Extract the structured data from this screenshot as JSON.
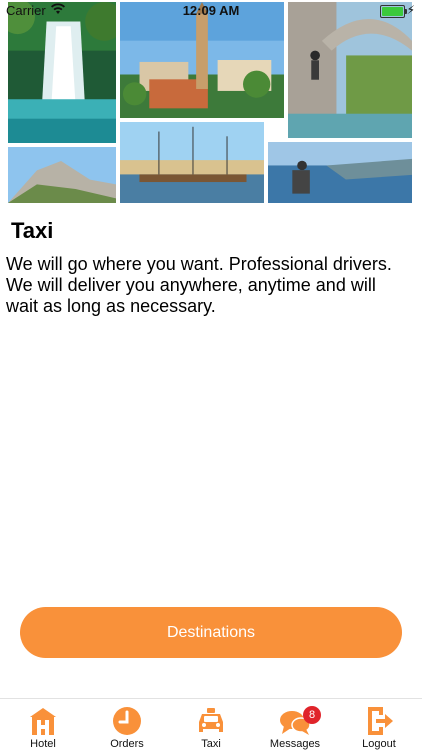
{
  "status_bar": {
    "carrier": "Carrier",
    "time": "12:09 AM",
    "battery_level": 1.0
  },
  "page": {
    "title": "Taxi",
    "description": "We will go where you want. Professional drivers. We will deliver you anywhere, anytime and will wait as long as necessary."
  },
  "primary_button": {
    "label": "Destinations"
  },
  "tabbar": {
    "items": [
      {
        "label": "Hotel",
        "icon": "hotel-icon"
      },
      {
        "label": "Orders",
        "icon": "clock-icon"
      },
      {
        "label": "Taxi",
        "icon": "taxi-icon"
      },
      {
        "label": "Messages",
        "icon": "chat-bubbles-icon",
        "badge": "8"
      },
      {
        "label": "Logout",
        "icon": "logout-icon"
      }
    ]
  },
  "colors": {
    "accent": "#f9913a",
    "badge": "#e0242b",
    "battery": "#3cc93c"
  }
}
